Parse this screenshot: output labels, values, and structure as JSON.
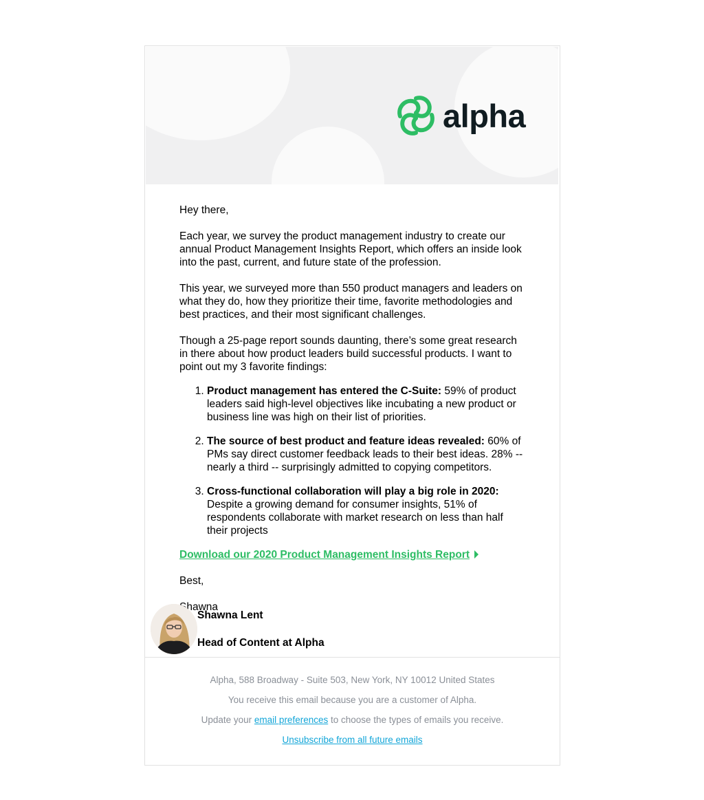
{
  "brand": {
    "name": "alpha",
    "logo_icon": "alpha-swirl-logo",
    "green": "#2dbd64",
    "dark": "#101c21"
  },
  "email": {
    "greeting": "Hey there,",
    "para1": "Each year, we survey the product management industry to create our annual Product Management Insights Report, which offers an inside look into the past, current, and future state of the profession.",
    "para2": "This year, we surveyed more than 550 product managers and leaders on what they do, how they prioritize their time, favorite methodologies and best practices, and their most significant challenges.",
    "para3": "Though a 25-page report sounds daunting, there’s some great research in there about how product leaders build successful products. I want to point out my 3 favorite findings:",
    "findings": [
      {
        "title": "Product management has entered the C-Suite:",
        "text": " 59% of product leaders said high-level objectives like incubating a new product or business line was high on their list of priorities."
      },
      {
        "title": "The source of best product and feature ideas revealed:",
        "text": " 60% of PMs say direct customer feedback leads to their best ideas. 28% -- nearly a third -- surprisingly admitted to copying competitors."
      },
      {
        "title": "Cross-functional collaboration will play a big role in 2020:",
        "text": " Despite a growing demand for consumer insights, 51% of respondents collaborate with market research on less than half their projects"
      }
    ],
    "cta_label": "Download our 2020 Product Management Insights Report",
    "signoff": "Best,",
    "signoff_name": "Shawna"
  },
  "signature": {
    "name": "Shawna Lent",
    "title": "Head of Content at Alpha"
  },
  "footer": {
    "address": "Alpha, 588 Broadway - Suite 503, New York, NY 10012 United States",
    "reason": "You receive this email because you are a customer of Alpha.",
    "prefs_prefix": "Update your ",
    "prefs_link": "email preferences",
    "prefs_suffix": " to choose the types of emails you receive.",
    "unsubscribe": "Unsubscribe from all future emails"
  }
}
